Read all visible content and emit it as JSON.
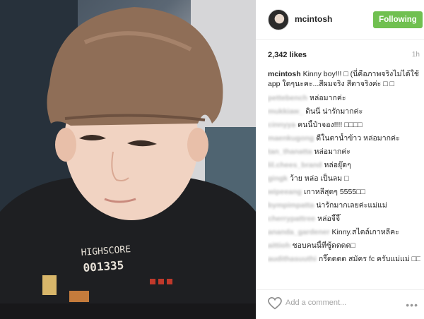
{
  "post": {
    "username": "mcintosh",
    "follow_label": "Following",
    "likes": "2,342 likes",
    "time": "1h",
    "caption": "Kinny boy!!! □ (นี่คือภาพจริงไม่ได้ใช้ app ใดๆนะคะ...สีผมจริง สีตาจริงค่ะ □ □"
  },
  "comments": [
    {
      "user": "pettebench",
      "text": "หล่อมากค่ะ"
    },
    {
      "user": "mukkiaw_",
      "text": "ดินนี่ น่ารักมากค่ะ"
    },
    {
      "user": "cinnyya",
      "text": "คนนี้ป๋าจอง!!!! □□□□"
    },
    {
      "user": "maenkugong",
      "text": "ดีในตาน้ำข้าว หล่อมากค่ะ"
    },
    {
      "user": "tan_thanatta",
      "text": "หล่อมากค่ะ"
    },
    {
      "user": "lil.chees_brand",
      "text": "หล่อยุ๊ดๆ"
    },
    {
      "user": "gingk",
      "text": "ว้าย หล่อ เป็นลม □"
    },
    {
      "user": "wipeeang",
      "text": "เกาหลีสุดๆ 5555□□"
    },
    {
      "user": "bympimpatta",
      "text": "น่ารักมากเลยค่ะแม่แม่"
    },
    {
      "user": "cherrypattree",
      "text": "หล่อจี๊จี๊"
    },
    {
      "user": "ananda_gardener",
      "text": "Kinny.สไตล์เกาหลีคะ"
    },
    {
      "user": "aittioh",
      "text": "ชอบคนนี้ที่ซู้ดดดด□"
    },
    {
      "user": "audithasuuthi",
      "text": "กรี๊ดดดด สมัคร fc ครับแม่แม่ □□□"
    }
  ],
  "footer": {
    "placeholder": "Add a comment...",
    "more": "•••"
  },
  "photo": {
    "shirt_print": "HIGHSCORE",
    "shirt_digits": "001335"
  },
  "colors": {
    "follow_bg": "#70c050",
    "text": "#262626",
    "muted": "#a5a5a5"
  }
}
